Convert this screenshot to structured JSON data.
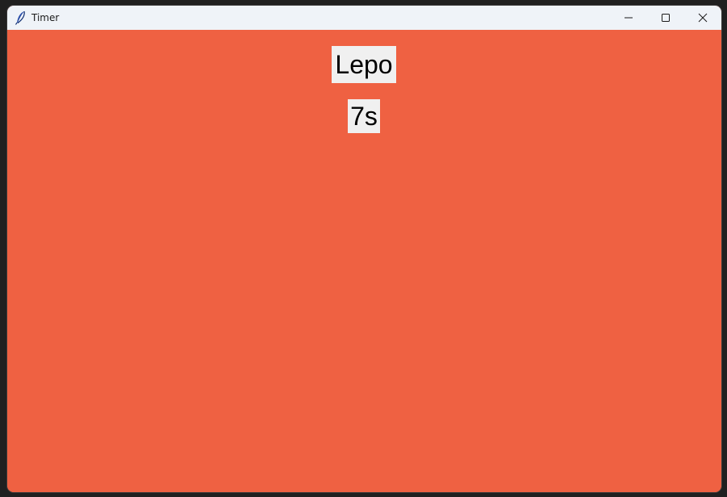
{
  "window": {
    "title": "Timer",
    "background_color": "#ef6142",
    "titlebar_color": "#eff3f8"
  },
  "controls": {
    "minimize_icon": "minimize-icon",
    "maximize_icon": "maximize-icon",
    "close_icon": "close-icon"
  },
  "timer": {
    "phase": "Lepo",
    "remaining": "7s"
  }
}
